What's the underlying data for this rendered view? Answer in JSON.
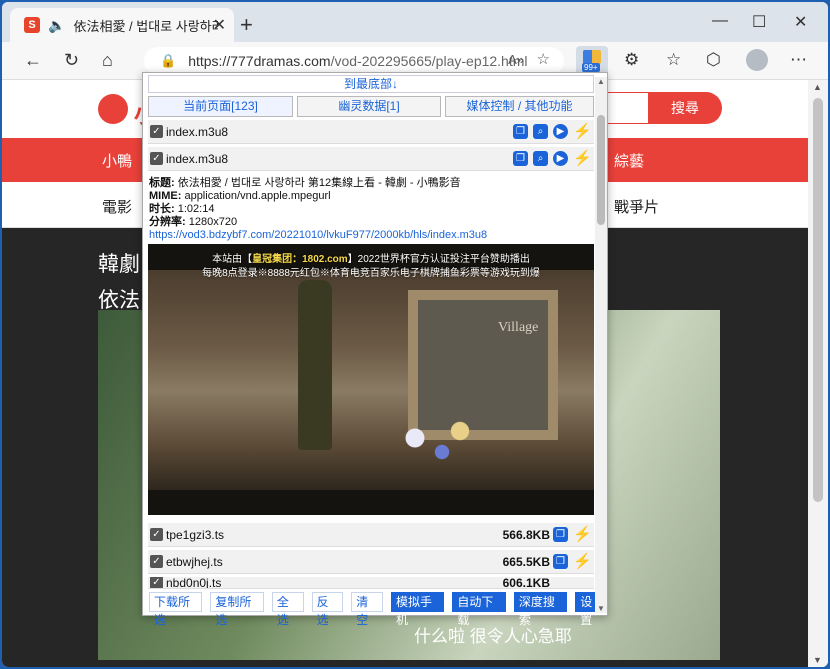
{
  "browser": {
    "tab_title": "依法相愛 / 법대로 사랑하라",
    "url_host": "https://777dramas.com",
    "url_path": "/vod-202295665/play-ep12.html",
    "ext_badge": "99+",
    "read_aloud": "A»",
    "new_tab": "+",
    "minimize": "—",
    "maximize": "☐",
    "close": "✕",
    "tab_close": "✕",
    "favicon_letter": "S"
  },
  "site": {
    "search_button": "搜尋",
    "nav_left": "小鴨",
    "nav_right": "綜藝",
    "subnav_left": "電影",
    "subnav_right": "戰爭片",
    "heading_line1": "韓劇",
    "heading_line2": "依法",
    "video_subtitle": "什么啦 很令人心急耶",
    "logo_letter": "小"
  },
  "popup": {
    "to_bottom": "到最底部↓",
    "tabs": [
      {
        "label": "当前页面[123]"
      },
      {
        "label": "幽灵数据[1]"
      },
      {
        "label": "媒体控制 / 其他功能"
      }
    ],
    "rows_top": [
      {
        "name": "index.m3u8"
      },
      {
        "name": "index.m3u8"
      }
    ],
    "info": {
      "title_label": "标题:",
      "title_value": "依法相愛 / 법대로 사랑하라 第12集線上看 - 韓劇 - 小鴨影音",
      "mime_label": "MIME:",
      "mime_value": "application/vnd.apple.mpegurl",
      "duration_label": "时长:",
      "duration_value": "1:02:14",
      "resolution_label": "分辨率:",
      "resolution_value": "1280x720",
      "link": "https://vod3.bdzybf7.com/20221010/lvkuF977/2000kb/hls/index.m3u8"
    },
    "preview_caption_pre": "本站由【",
    "preview_caption_hl": "皇冠集团：1802.com",
    "preview_caption_post": "】2022世界杯官方认证投注平台赞助播出",
    "preview_caption2": "每晚8点登录※8888元红包※体育电竞百家乐电子棋牌捕鱼彩票等游戏玩到爆",
    "preview_frame_label": "Village",
    "rows_bottom": [
      {
        "name": "tpe1gzi3.ts",
        "size": "566.8KB"
      },
      {
        "name": "etbwjhej.ts",
        "size": "665.5KB"
      },
      {
        "name": "nbd0n0j.ts",
        "size": "606.1KB"
      }
    ],
    "actions": [
      {
        "label": "下载所选",
        "style": "outline"
      },
      {
        "label": "复制所选",
        "style": "outline"
      },
      {
        "label": "全选",
        "style": "outline"
      },
      {
        "label": "反选",
        "style": "outline"
      },
      {
        "label": "清空",
        "style": "outline"
      },
      {
        "label": "模拟手机",
        "style": "solid"
      },
      {
        "label": "自动下载",
        "style": "solid"
      },
      {
        "label": "深度搜索",
        "style": "solid"
      },
      {
        "label": "设置",
        "style": "solid"
      }
    ]
  },
  "colors": {
    "accent": "#1a63d8",
    "site_red": "#e8413a"
  }
}
